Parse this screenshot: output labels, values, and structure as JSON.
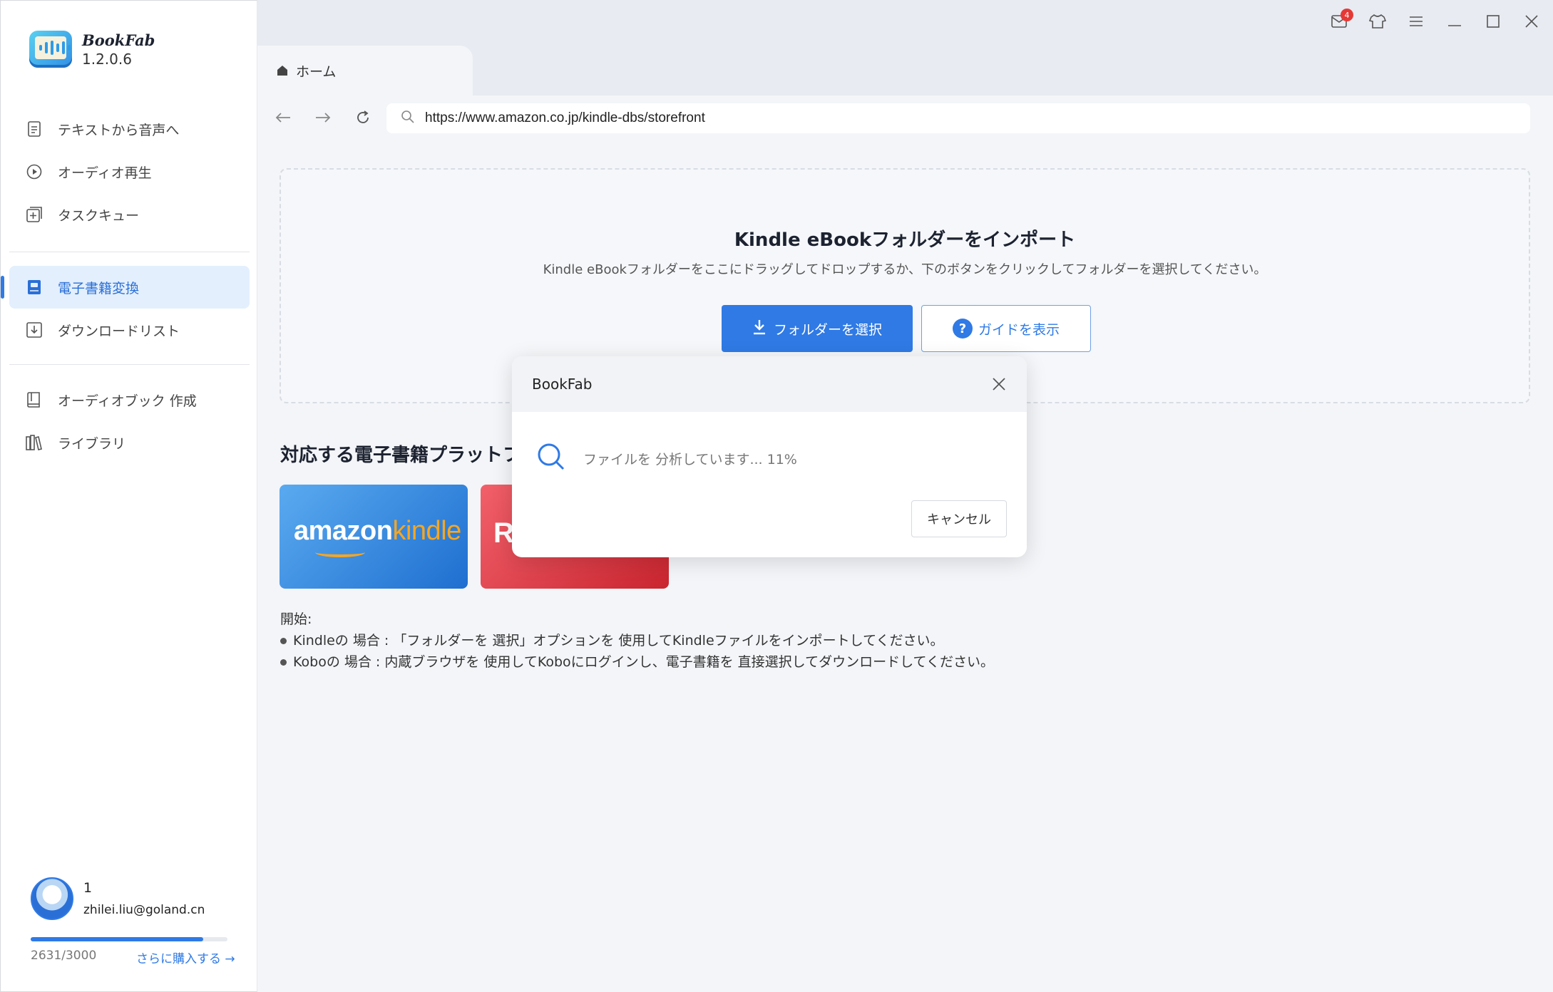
{
  "app": {
    "name": "BookFab",
    "version": "1.2.0.6"
  },
  "sidebar": {
    "items": [
      {
        "label": "テキストから音声へ",
        "icon": "document-icon"
      },
      {
        "label": "オーディオ再生",
        "icon": "play-circle-icon"
      },
      {
        "label": "タスクキュー",
        "icon": "queue-add-icon"
      },
      {
        "label": "電子書籍変換",
        "icon": "ebook-icon",
        "active": true
      },
      {
        "label": "ダウンロードリスト",
        "icon": "download-box-icon"
      },
      {
        "label": "オーディオブック 作成",
        "icon": "audiobook-icon"
      },
      {
        "label": "ライブラリ",
        "icon": "library-icon"
      }
    ]
  },
  "user": {
    "name": "1",
    "email": "zhilei.liu@goland.cn",
    "quota_text": "2631/3000",
    "quota_fraction": 0.877,
    "buy_link": "さらに購入する →"
  },
  "titlebar": {
    "tab_label": "ホーム",
    "mail_badge": "4"
  },
  "browser": {
    "url": "https://www.amazon.co.jp/kindle-dbs/storefront"
  },
  "import": {
    "title": "Kindle eBookフォルダーをインポート",
    "subtitle": "Kindle eBookフォルダーをここにドラッグしてドロップするか、下のボタンをクリックしてフォルダーを選択してください。",
    "select_button": "フォルダーを選択",
    "guide_button": "ガイドを表示"
  },
  "platforms": {
    "title": "対応する電子書籍プラットフォ",
    "kindle_logo_a": "amazon",
    "kindle_logo_b": "kindle",
    "kobo_logo": "Ro"
  },
  "howto": {
    "heading": "開始:",
    "lines": [
      "Kindleの 場合 : 「フォルダーを 選択」オプションを 使用してKindleファイルをインポートしてください。",
      "Koboの 場合 : 内蔵ブラウザを 使用してKoboにログインし、電子書籍を 直接選択してダウンロードしてください。"
    ]
  },
  "dialog": {
    "title": "BookFab",
    "message": "ファイルを 分析しています... 11%",
    "cancel": "キャンセル"
  },
  "colors": {
    "accent": "#2f7ae5",
    "active_bg": "#e3effd",
    "badge": "#e53935"
  }
}
